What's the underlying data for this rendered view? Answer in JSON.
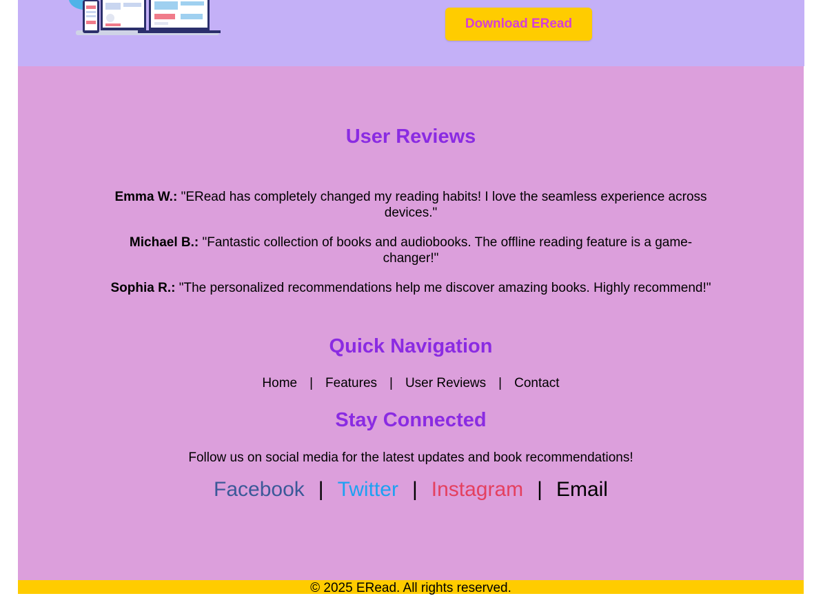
{
  "hero": {
    "download_label": "Download ERead",
    "illustration_icon": "devices-illustration-icon"
  },
  "reviews": {
    "title": "User Reviews",
    "items": [
      {
        "name": "Emma W.:",
        "text": "\"ERead has completely changed my reading habits! I love the seamless experience across devices.\""
      },
      {
        "name": "Michael B.:",
        "text": "\"Fantastic collection of books and audiobooks. The offline reading feature is a game-changer!\""
      },
      {
        "name": "Sophia R.:",
        "text": "\"The personalized recommendations help me discover amazing books. Highly recommend!\""
      }
    ]
  },
  "quick_nav": {
    "title": "Quick Navigation",
    "separator": "|",
    "links": [
      "Home",
      "Features",
      "User Reviews",
      "Contact"
    ]
  },
  "connect": {
    "title": "Stay Connected",
    "text": "Follow us on social media for the latest updates and book recommendations!",
    "separator": "|",
    "links": [
      {
        "label": "Facebook",
        "color": "#3b5998"
      },
      {
        "label": "Twitter",
        "color": "#1da1f2"
      },
      {
        "label": "Instagram",
        "color": "#e4405f"
      },
      {
        "label": "Email",
        "color": "#000000"
      }
    ]
  },
  "footer": {
    "text": "© 2025 ERead. All rights reserved."
  },
  "colors": {
    "hero_bg": "#c4b0f7",
    "main_bg": "#dc9fdc",
    "accent": "#8a2be2",
    "button_bg": "#ffcc00",
    "button_text": "#d63fd6",
    "footer_bg": "#ffcc00"
  }
}
